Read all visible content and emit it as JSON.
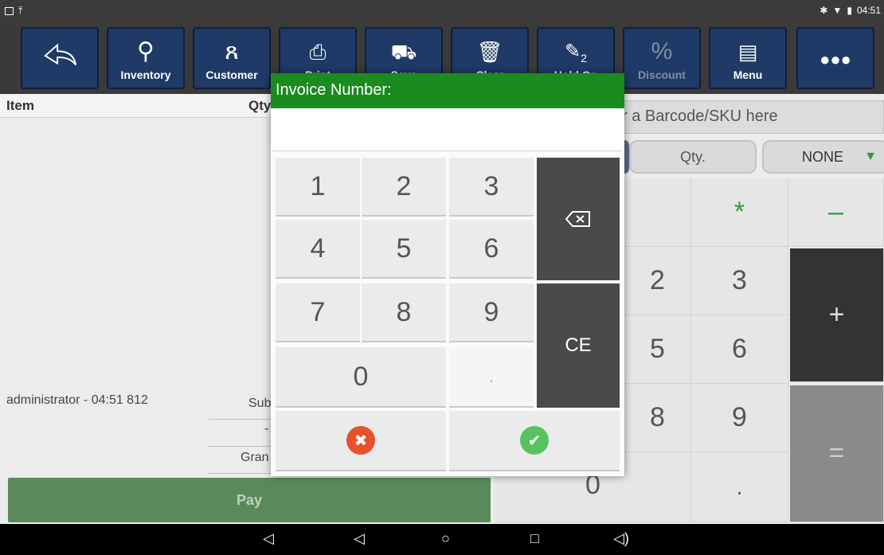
{
  "status_bar": {
    "time": "04:51"
  },
  "toolbar": {
    "items": [
      {
        "label": "",
        "icon": "back-arrow-icon"
      },
      {
        "label": "Inventory",
        "icon": "search-icon"
      },
      {
        "label": "Customer",
        "icon": "add-person-icon"
      },
      {
        "label": "Print",
        "icon": "printer-icon"
      },
      {
        "label": "Save",
        "icon": "cart-icon"
      },
      {
        "label": "Clear",
        "icon": "trash-icon"
      },
      {
        "label": "Hold On",
        "icon": "pin-icon",
        "badge": "2"
      },
      {
        "label": "Discount",
        "icon": "percent-icon"
      },
      {
        "label": "Menu",
        "icon": "clipboard-icon"
      },
      {
        "label": "",
        "icon": "more-icon"
      }
    ]
  },
  "order": {
    "col_item": "Item",
    "col_qty": "Qty"
  },
  "footer": {
    "user_line": "administrator - 04:51 812",
    "subtotal_label": "Sub",
    "dash": "-",
    "grand_label": "Gran",
    "pay_label": "Pay"
  },
  "right_panel": {
    "barcode_placeholder": "r a Barcode/SKU here",
    "qty_label": "Qty.",
    "none_label": "NONE",
    "keys": [
      "*",
      "–",
      "2",
      "3",
      "+",
      "5",
      "6",
      "8",
      "9",
      "=",
      "0",
      "."
    ]
  },
  "dialog": {
    "title": "Invoice Number:",
    "input_value": "",
    "keys": [
      "1",
      "2",
      "3",
      "4",
      "5",
      "6",
      "7",
      "8",
      "9",
      "0",
      "."
    ],
    "clear_label": "CE"
  },
  "colors": {
    "title_green": "#1b8a1f",
    "toolbar_blue": "#1f3a66",
    "cancel_red": "#e8502e",
    "ok_green": "#57c25e"
  }
}
